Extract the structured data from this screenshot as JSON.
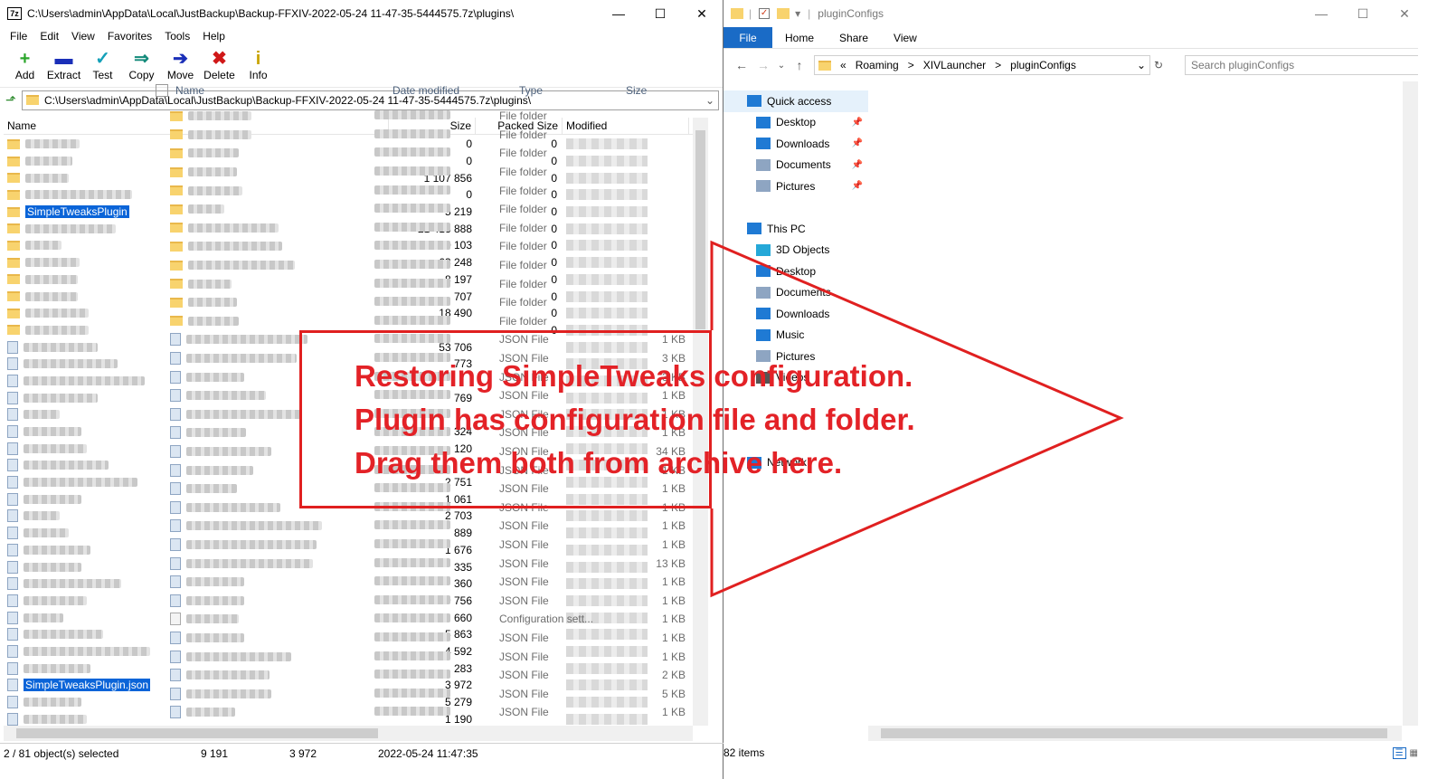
{
  "archiver": {
    "title": "C:\\Users\\admin\\AppData\\Local\\JustBackup\\Backup-FFXIV-2022-05-24 11-47-35-5444575.7z\\plugins\\",
    "menu": [
      "File",
      "Edit",
      "View",
      "Favorites",
      "Tools",
      "Help"
    ],
    "toolbar": [
      {
        "label": "Add",
        "icon": "plus-icon",
        "color": "#2aa52a",
        "glyph": "+"
      },
      {
        "label": "Extract",
        "icon": "minus-icon",
        "color": "#1a2fb8",
        "glyph": "▬"
      },
      {
        "label": "Test",
        "icon": "test-icon",
        "color": "#14a0b8",
        "glyph": "✓"
      },
      {
        "label": "Copy",
        "icon": "copy-icon",
        "color": "#138a7a",
        "glyph": "⇒"
      },
      {
        "label": "Move",
        "icon": "move-icon",
        "color": "#1a2fb8",
        "glyph": "➔"
      },
      {
        "label": "Delete",
        "icon": "delete-icon",
        "color": "#d01818",
        "glyph": "✖"
      },
      {
        "label": "Info",
        "icon": "info-icon",
        "color": "#c9a400",
        "glyph": "i"
      }
    ],
    "address": "C:\\Users\\admin\\AppData\\Local\\JustBackup\\Backup-FFXIV-2022-05-24 11-47-35-5444575.7z\\plugins\\",
    "columns": {
      "name": "Name",
      "size": "Size",
      "packed": "Packed Size",
      "modified": "Modified"
    },
    "rows": [
      {
        "kind": "folder",
        "name": "",
        "w": 60,
        "size": "0",
        "packed": "0"
      },
      {
        "kind": "folder",
        "name": "",
        "w": 52,
        "size": "0",
        "packed": "0"
      },
      {
        "kind": "folder",
        "name": "",
        "w": 48,
        "size": "1 107 856",
        "packed": "0"
      },
      {
        "kind": "folder",
        "name": "",
        "w": 118,
        "size": "0",
        "packed": "0"
      },
      {
        "kind": "folder",
        "name": "SimpleTweaksPlugin",
        "selected": true,
        "size": "5 219",
        "packed": "0"
      },
      {
        "kind": "folder",
        "name": "",
        "w": 100,
        "size": "21 413 888",
        "packed": "0"
      },
      {
        "kind": "folder",
        "name": "",
        "w": 40,
        "size": "500 103",
        "packed": "0"
      },
      {
        "kind": "folder",
        "name": "",
        "w": 60,
        "size": "63 248",
        "packed": "0"
      },
      {
        "kind": "folder",
        "name": "",
        "w": 58,
        "size": "8 197",
        "packed": "0"
      },
      {
        "kind": "folder",
        "name": "",
        "w": 58,
        "size": "707",
        "packed": "0"
      },
      {
        "kind": "folder",
        "name": "",
        "w": 70,
        "size": "18 490",
        "packed": "0"
      },
      {
        "kind": "folder",
        "name": "",
        "w": 70,
        "size": "",
        "packed": "0"
      },
      {
        "kind": "file",
        "name": "",
        "w": 82,
        "size": "53 706",
        "packed": ""
      },
      {
        "kind": "file",
        "name": "",
        "w": 104,
        "size": "773",
        "packed": ""
      },
      {
        "kind": "file",
        "name": "",
        "w": 134,
        "size": "",
        "packed": ""
      },
      {
        "kind": "file",
        "name": "",
        "w": 82,
        "size": "769",
        "packed": ""
      },
      {
        "kind": "file",
        "name": "",
        "w": 40,
        "size": "",
        "packed": ""
      },
      {
        "kind": "file",
        "name": "",
        "w": 64,
        "size": "324",
        "packed": ""
      },
      {
        "kind": "file",
        "name": "",
        "w": 70,
        "size": "120",
        "packed": ""
      },
      {
        "kind": "file",
        "name": "",
        "w": 94,
        "size": "",
        "packed": ""
      },
      {
        "kind": "file",
        "name": "",
        "w": 126,
        "size": "2 751",
        "packed": ""
      },
      {
        "kind": "file",
        "name": "",
        "w": 64,
        "size": "1 061",
        "packed": ""
      },
      {
        "kind": "file",
        "name": "",
        "w": 40,
        "size": "2 703",
        "packed": ""
      },
      {
        "kind": "file",
        "name": "",
        "w": 50,
        "size": "889",
        "packed": ""
      },
      {
        "kind": "file",
        "name": "",
        "w": 74,
        "size": "1 676",
        "packed": ""
      },
      {
        "kind": "file",
        "name": "",
        "w": 64,
        "size": "335",
        "packed": ""
      },
      {
        "kind": "file",
        "name": "",
        "w": 108,
        "size": "360",
        "packed": ""
      },
      {
        "kind": "file",
        "name": "",
        "w": 70,
        "size": "209 756",
        "packed": ""
      },
      {
        "kind": "file",
        "name": "",
        "w": 44,
        "size": "660",
        "packed": ""
      },
      {
        "kind": "file",
        "name": "",
        "w": 88,
        "size": "5 863",
        "packed": ""
      },
      {
        "kind": "file",
        "name": "",
        "w": 140,
        "size": "4 592",
        "packed": ""
      },
      {
        "kind": "file",
        "name": "",
        "w": 74,
        "size": "283",
        "packed": ""
      },
      {
        "kind": "file",
        "name": "SimpleTweaksPlugin.json",
        "selected": true,
        "size": "3 972",
        "packed": ""
      },
      {
        "kind": "file",
        "name": "",
        "w": 64,
        "size": "5 279",
        "packed": ""
      },
      {
        "kind": "file",
        "name": "",
        "w": 70,
        "size": "1 190",
        "packed": ""
      }
    ],
    "status": {
      "selected": "2 / 81 object(s) selected",
      "size": "9 191",
      "packed": "3 972",
      "modified": "2022-05-24 11:47:35"
    }
  },
  "explorer": {
    "title": "pluginConfigs",
    "ribbon": [
      "File",
      "Home",
      "Share",
      "View"
    ],
    "breadcrumb": [
      "«",
      "Roaming",
      ">",
      "XIVLauncher",
      ">",
      "pluginConfigs"
    ],
    "search_placeholder": "Search pluginConfigs",
    "nav": [
      {
        "label": "Quick access",
        "top": true,
        "icon": "star-icon",
        "color": "#1f7ad4"
      },
      {
        "label": "Desktop",
        "icon": "desktop-icon",
        "color": "#1f7ad4",
        "pin": true
      },
      {
        "label": "Downloads",
        "icon": "download-icon",
        "color": "#1f7ad4",
        "pin": true
      },
      {
        "label": "Documents",
        "icon": "documents-icon",
        "color": "#8ea5c2",
        "pin": true
      },
      {
        "label": "Pictures",
        "icon": "pictures-icon",
        "color": "#8ea5c2",
        "pin": true
      },
      {
        "label": "",
        "spacer": true
      },
      {
        "label": "This PC",
        "top": true,
        "icon": "pc-icon",
        "color": "#1f7ad4"
      },
      {
        "label": "3D Objects",
        "icon": "3d-objects-icon",
        "color": "#25a8d8"
      },
      {
        "label": "Desktop",
        "icon": "desktop-icon",
        "color": "#1f7ad4"
      },
      {
        "label": "Documents",
        "icon": "documents-icon",
        "color": "#8ea5c2"
      },
      {
        "label": "Downloads",
        "icon": "download-icon",
        "color": "#1f7ad4"
      },
      {
        "label": "Music",
        "icon": "music-icon",
        "color": "#1f7ad4"
      },
      {
        "label": "Pictures",
        "icon": "pictures-icon",
        "color": "#8ea5c2"
      },
      {
        "label": "Videos",
        "icon": "videos-icon",
        "color": "#555"
      },
      {
        "label": "",
        "spacer": true
      },
      {
        "label": "",
        "spacer": true
      },
      {
        "label": "",
        "spacer": true
      },
      {
        "label": "Network",
        "top": true,
        "icon": "network-icon",
        "color": "#1f7ad4"
      }
    ],
    "columns": {
      "name": "Name",
      "date": "Date modified",
      "type": "Type",
      "size": "Size"
    },
    "rows": [
      {
        "kind": "folder",
        "w": 70,
        "type": "File folder",
        "size": ""
      },
      {
        "kind": "folder",
        "w": 70,
        "type": "File folder",
        "size": ""
      },
      {
        "kind": "folder",
        "w": 56,
        "type": "File folder",
        "size": ""
      },
      {
        "kind": "folder",
        "w": 54,
        "type": "File folder",
        "size": ""
      },
      {
        "kind": "folder",
        "w": 60,
        "type": "File folder",
        "size": ""
      },
      {
        "kind": "folder",
        "w": 40,
        "type": "File folder",
        "size": ""
      },
      {
        "kind": "folder",
        "w": 100,
        "type": "File folder",
        "size": ""
      },
      {
        "kind": "folder",
        "w": 104,
        "type": "File folder",
        "size": ""
      },
      {
        "kind": "folder",
        "w": 118,
        "type": "File folder",
        "size": ""
      },
      {
        "kind": "folder",
        "w": 48,
        "type": "File folder",
        "size": ""
      },
      {
        "kind": "folder",
        "w": 54,
        "type": "File folder",
        "size": ""
      },
      {
        "kind": "folder",
        "w": 56,
        "type": "File folder",
        "size": ""
      },
      {
        "kind": "file",
        "w": 134,
        "type": "JSON File",
        "size": "1 KB"
      },
      {
        "kind": "file",
        "w": 122,
        "type": "JSON File",
        "size": "3 KB"
      },
      {
        "kind": "file",
        "w": 64,
        "type": "JSON File",
        "size": "3 KB"
      },
      {
        "kind": "file",
        "w": 88,
        "type": "JSON File",
        "size": "1 KB"
      },
      {
        "kind": "file",
        "w": 128,
        "type": "JSON File",
        "size": "1 KB"
      },
      {
        "kind": "file",
        "w": 66,
        "type": "JSON File",
        "size": "1 KB"
      },
      {
        "kind": "file",
        "w": 94,
        "type": "JSON File",
        "size": "34 KB"
      },
      {
        "kind": "file",
        "w": 74,
        "type": "JSON File",
        "size": "1 KB"
      },
      {
        "kind": "file",
        "w": 56,
        "type": "JSON File",
        "size": "1 KB"
      },
      {
        "kind": "file",
        "w": 104,
        "type": "JSON File",
        "size": "1 KB"
      },
      {
        "kind": "file",
        "w": 150,
        "type": "JSON File",
        "size": "1 KB"
      },
      {
        "kind": "file",
        "w": 144,
        "type": "JSON File",
        "size": "1 KB"
      },
      {
        "kind": "file",
        "w": 140,
        "type": "JSON File",
        "size": "13 KB"
      },
      {
        "kind": "file",
        "w": 64,
        "type": "JSON File",
        "size": "1 KB"
      },
      {
        "kind": "file",
        "w": 64,
        "type": "JSON File",
        "size": "1 KB"
      },
      {
        "kind": "config",
        "w": 58,
        "type": "Configuration sett...",
        "size": "1 KB"
      },
      {
        "kind": "file",
        "w": 64,
        "type": "JSON File",
        "size": "1 KB"
      },
      {
        "kind": "file",
        "w": 116,
        "type": "JSON File",
        "size": "1 KB"
      },
      {
        "kind": "file",
        "w": 92,
        "type": "JSON File",
        "size": "2 KB"
      },
      {
        "kind": "file",
        "w": 94,
        "type": "JSON File",
        "size": "5 KB"
      },
      {
        "kind": "file",
        "w": 54,
        "type": "JSON File",
        "size": "1 KB"
      }
    ],
    "status": "82 items"
  },
  "annotation": {
    "lines": [
      "Restoring SimpleTweaks configuration.",
      "Plugin has configuration file and folder.",
      "Drag them both from archive here."
    ],
    "color": "#e32227"
  }
}
